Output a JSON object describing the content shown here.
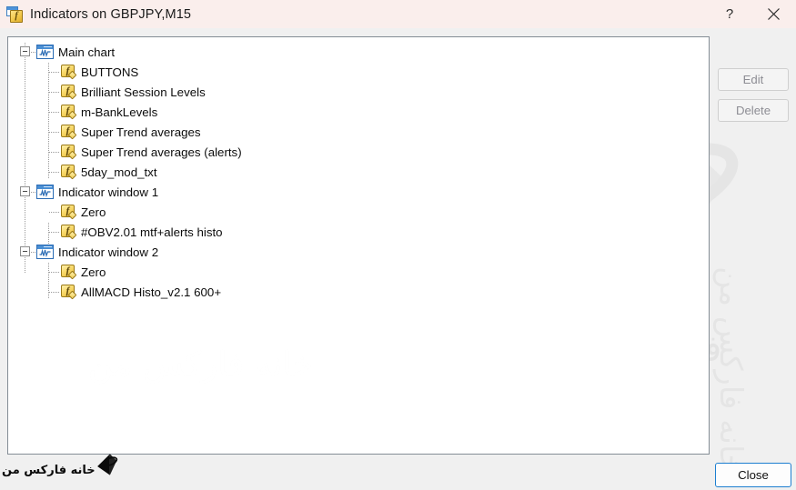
{
  "window": {
    "title": "Indicators on GBPJPY,M15",
    "icon": "indicator-window-icon",
    "help_label": "?",
    "close_label": "×"
  },
  "colors": {
    "titlebar_bg": "#faeeec",
    "body_bg": "#f0f0f0",
    "panel_bg": "#ffffff",
    "panel_border": "#848d95",
    "focus_border": "#1d7fd0",
    "disabled_text": "#8d8d94",
    "icon_yellow": "#f2c84b",
    "icon_blue": "#4a8fd4"
  },
  "tree": {
    "groups": [
      {
        "name": "Main chart",
        "icon": "chart-window-icon",
        "expanded": true,
        "items": [
          {
            "name": "BUTTONS",
            "icon": "fx-icon"
          },
          {
            "name": "Brilliant Session Levels",
            "icon": "fx-icon"
          },
          {
            "name": "m-BankLevels",
            "icon": "fx-icon"
          },
          {
            "name": "Super Trend averages",
            "icon": "fx-icon"
          },
          {
            "name": "Super Trend averages (alerts)",
            "icon": "fx-icon"
          },
          {
            "name": "5day_mod_txt",
            "icon": "fx-icon"
          }
        ]
      },
      {
        "name": "Indicator window 1",
        "icon": "chart-window-icon",
        "expanded": true,
        "items": [
          {
            "name": "Zero",
            "icon": "fx-icon"
          },
          {
            "name": "#OBV2.01 mtf+alerts histo",
            "icon": "fx-icon"
          }
        ]
      },
      {
        "name": "Indicator window 2",
        "icon": "chart-window-icon",
        "expanded": true,
        "items": [
          {
            "name": "Zero",
            "icon": "fx-icon"
          },
          {
            "name": "AllMACD Histo_v2.1 600+",
            "icon": "fx-icon"
          }
        ]
      }
    ]
  },
  "buttons": {
    "edit": {
      "label": "Edit",
      "enabled": false
    },
    "delete": {
      "label": "Delete",
      "enabled": false
    },
    "close": {
      "label": "Close",
      "enabled": true,
      "focused": true
    }
  },
  "watermarks": {
    "center_text": "فارکس من",
    "left_text": "خانه فارکس من",
    "right_text": "خانه فارکس من",
    "logo_text": "خانه فارکس من"
  }
}
